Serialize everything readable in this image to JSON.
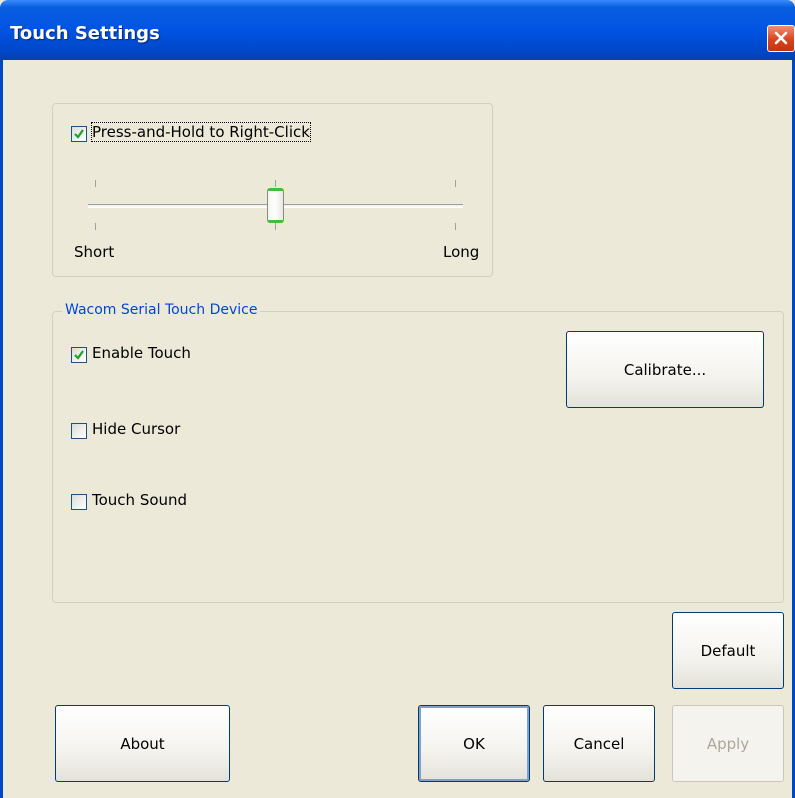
{
  "window": {
    "title": "Touch Settings"
  },
  "press_hold": {
    "checkbox_label": "Press-and-Hold to Right-Click",
    "checked": true,
    "slider_min_label": "Short",
    "slider_max_label": "Long",
    "slider_level": 0.5
  },
  "device_group": {
    "title": "Wacom Serial Touch Device",
    "enable_touch": {
      "label": "Enable Touch",
      "checked": true
    },
    "hide_cursor": {
      "label": "Hide Cursor",
      "checked": false
    },
    "touch_sound": {
      "label": "Touch Sound",
      "checked": false
    },
    "calibrate_label": "Calibrate..."
  },
  "buttons": {
    "default": "Default",
    "about": "About",
    "ok": "OK",
    "cancel": "Cancel",
    "apply": "Apply"
  },
  "colors": {
    "titlebar": "#0054e3",
    "dialog_bg": "#ece9d8",
    "group_title": "#0046d5",
    "slider_thumb_accent": "#3fbe3a"
  }
}
